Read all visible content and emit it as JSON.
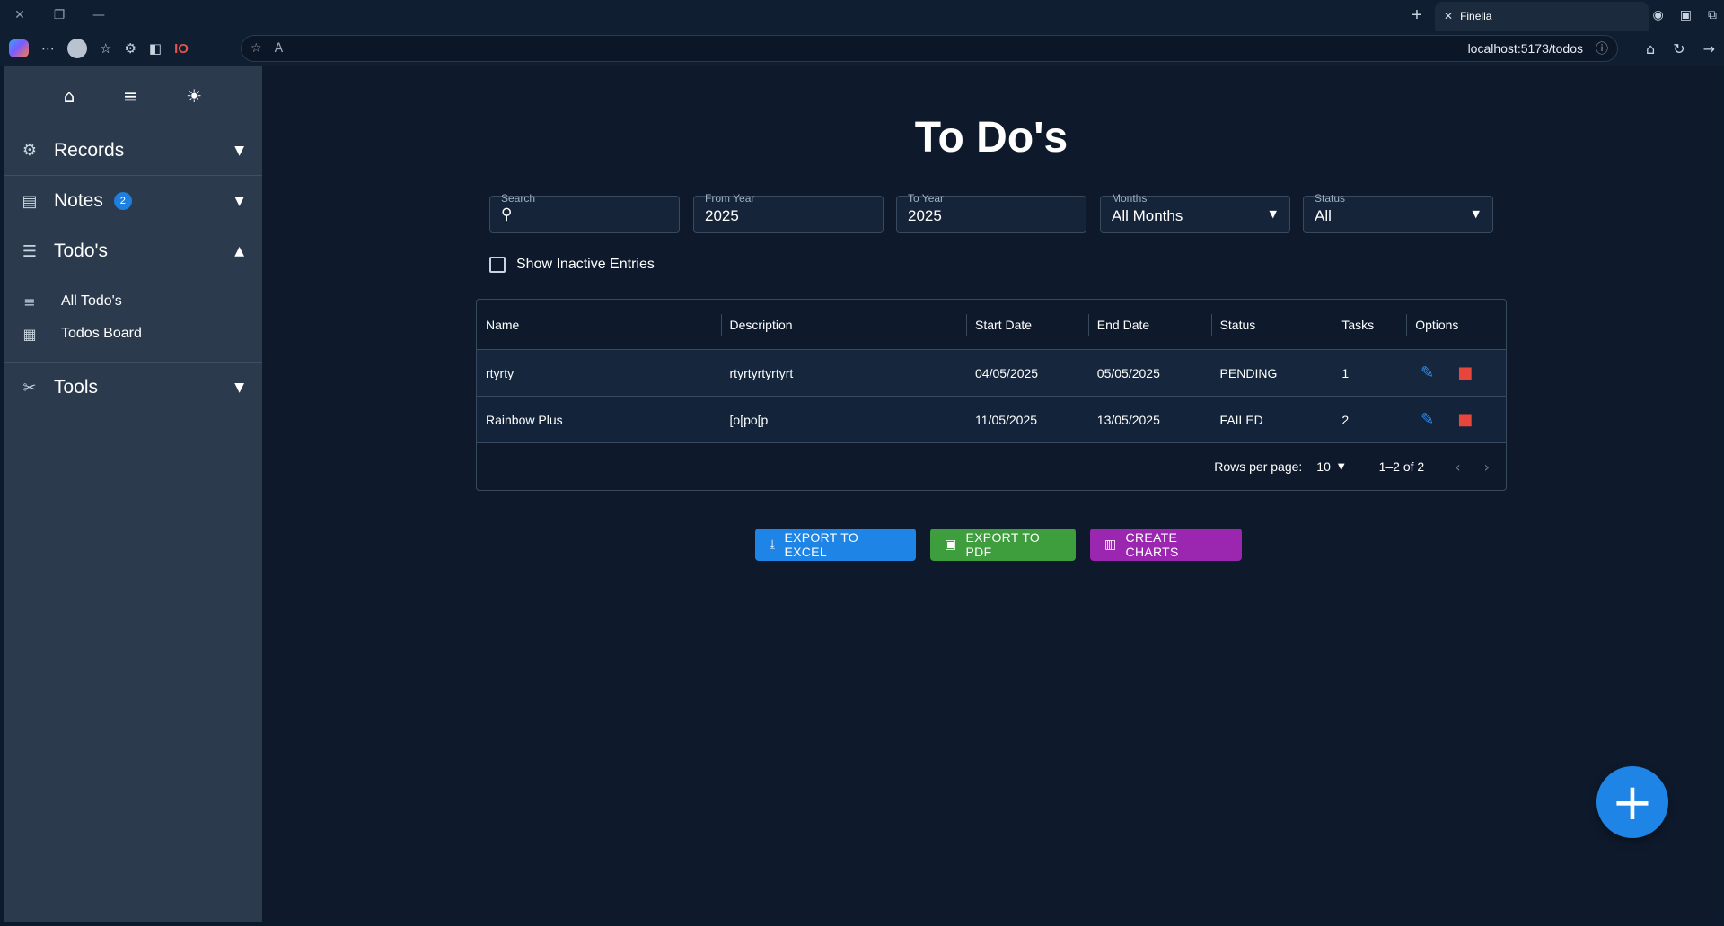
{
  "browser": {
    "tab_title": "Finella",
    "url": "localhost:5173/todos",
    "new_tab_symbol": "+",
    "toolbar_badge": "IO"
  },
  "sidebar": {
    "sections": [
      {
        "label": "Records",
        "icon": "records-icon"
      },
      {
        "label": "Notes",
        "icon": "notes-icon",
        "badge": "2"
      },
      {
        "label": "Todo's",
        "icon": "todos-icon"
      },
      {
        "label": "Tools",
        "icon": "tools-icon"
      }
    ],
    "todo_items": [
      {
        "label": "All Todo's",
        "icon": "list-edit-icon"
      },
      {
        "label": "Todos Board",
        "icon": "board-icon"
      }
    ]
  },
  "main": {
    "title": "To Do's",
    "filters": {
      "search": {
        "label": "Search",
        "value": ""
      },
      "from_year": {
        "label": "From Year",
        "value": "2025"
      },
      "to_year": {
        "label": "To Year",
        "value": "2025"
      },
      "months": {
        "label": "Months",
        "value": "All Months"
      },
      "status": {
        "label": "Status",
        "value": "All"
      }
    },
    "show_inactive_label": "Show Inactive Entries",
    "table": {
      "columns": [
        "Name",
        "Description",
        "Start Date",
        "End Date",
        "Status",
        "Tasks",
        "Options"
      ],
      "rows": [
        {
          "name": "rtyrty",
          "description": "rtyrtyrtyrtyrt",
          "start": "04/05/2025",
          "end": "05/05/2025",
          "status": "PENDING",
          "tasks": "1"
        },
        {
          "name": "Rainbow Plus",
          "description": "[o[po[p",
          "start": "11/05/2025",
          "end": "13/05/2025",
          "status": "FAILED",
          "tasks": "2"
        }
      ],
      "footer": {
        "rows_per_page_label": "Rows per page:",
        "rows_per_page": "10",
        "range": "1–2 of 2"
      }
    },
    "actions": {
      "export_excel": "EXPORT TO EXCEL",
      "export_pdf": "EXPORT TO PDF",
      "create_charts": "CREATE CHARTS"
    }
  },
  "colors": {
    "accent": "#1e84e6",
    "excel": "#1e84e6",
    "pdf": "#3e9e3e",
    "charts": "#9b27b0",
    "delete": "#e8453c"
  }
}
